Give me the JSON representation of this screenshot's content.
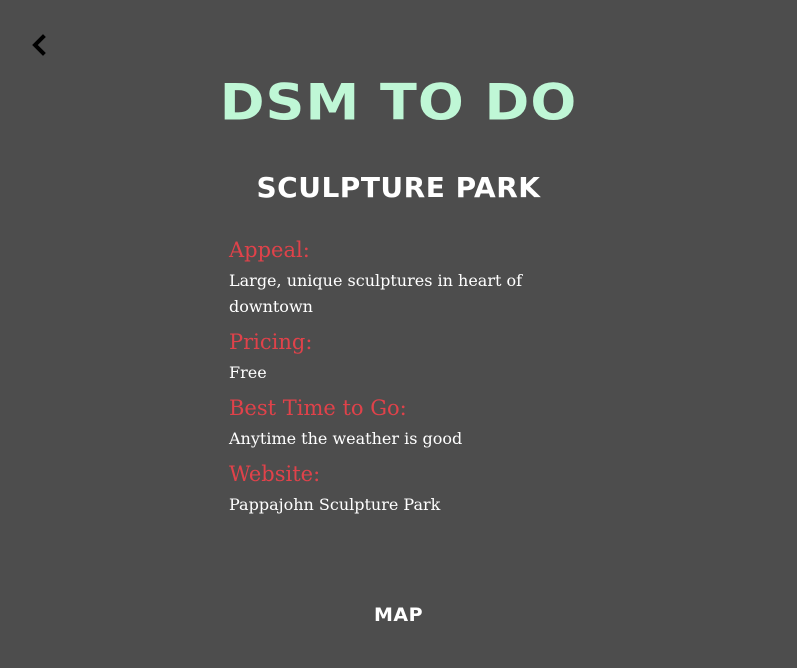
{
  "header": {
    "back_icon": "chevron-left-icon",
    "app_title": "DSM TO DO"
  },
  "place": {
    "title": "SCULPTURE PARK",
    "details": [
      {
        "label": "Appeal:",
        "value": "Large, unique sculptures in heart of downtown"
      },
      {
        "label": "Pricing:",
        "value": "Free"
      },
      {
        "label": "Best Time to Go:",
        "value": "Anytime the weather is good"
      },
      {
        "label": "Website:",
        "value": "Pappajohn Sculpture Park"
      }
    ]
  },
  "footer": {
    "map_label": "MAP"
  },
  "colors": {
    "background": "#4d4d4d",
    "title_accent": "#bff7d6",
    "label_accent": "#e0424a",
    "text": "#ffffff"
  }
}
